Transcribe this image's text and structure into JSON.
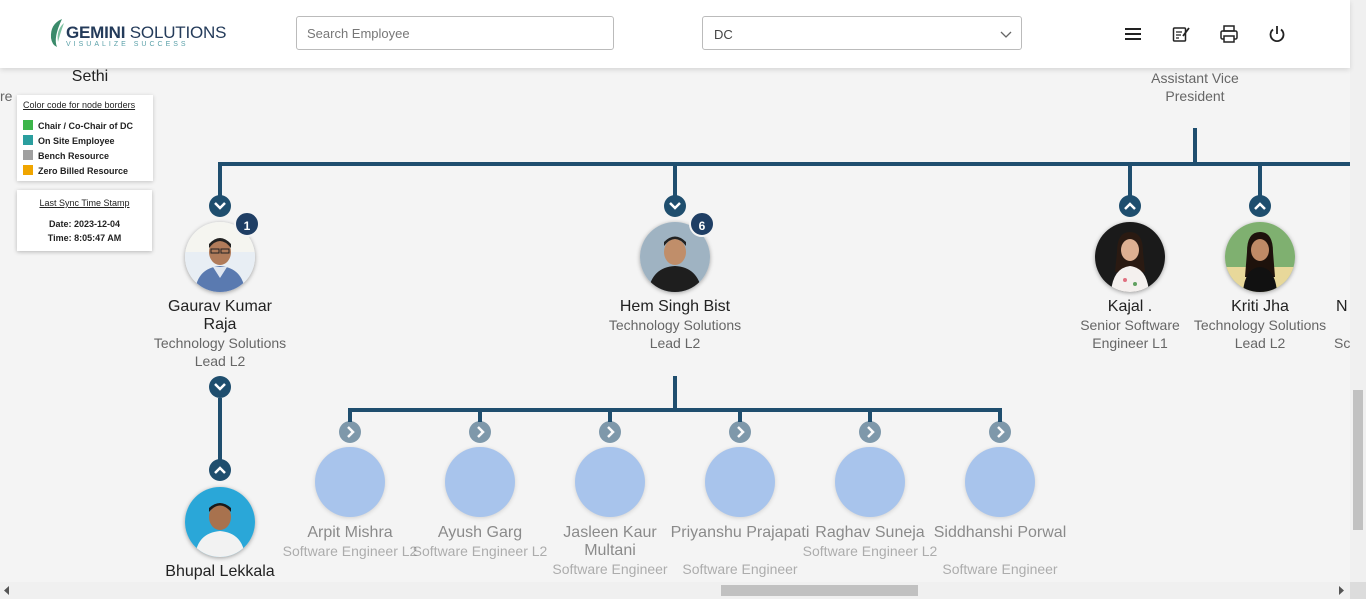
{
  "header": {
    "logo_brand": "GEMINI",
    "logo_suffix": "SOLUTIONS",
    "logo_tagline": "VISUALIZE SUCCESS",
    "search_placeholder": "Search Employee",
    "department_value": "DC",
    "icons": [
      "menu-icon",
      "notes-icon",
      "print-icon",
      "power-icon"
    ]
  },
  "legend": {
    "title": "Color code for node borders",
    "items": [
      {
        "label": "Chair / Co-Chair of DC",
        "color": "#3cb54a"
      },
      {
        "label": "On Site Employee",
        "color": "#2b9e9e"
      },
      {
        "label": "Bench Resource",
        "color": "#a0a0a0"
      },
      {
        "label": "Zero Billed Resource",
        "color": "#f0a500"
      }
    ]
  },
  "sync": {
    "title": "Last Sync Time Stamp",
    "date_line": "Date: 2023-12-04",
    "time_line": "Time: 8:05:47 AM"
  },
  "partial_nodes": {
    "left_name": "Sethi",
    "left_fragment": "re",
    "top_right_title": "Assistant Vice President",
    "right_edge_name": "N",
    "right_edge_title": "Sc"
  },
  "nodes": {
    "gaurav": {
      "name": "Gaurav Kumar Raja",
      "title": "Technology Solutions Lead L2",
      "badge": "1"
    },
    "hem": {
      "name": "Hem Singh Bist",
      "title": "Technology Solutions Lead L2",
      "badge": "6"
    },
    "kajal": {
      "name": "Kajal .",
      "title": "Senior Software Engineer L1"
    },
    "kriti": {
      "name": "Kriti Jha",
      "title": "Technology Solutions Lead L2"
    },
    "bhupal": {
      "name": "Bhupal Lekkala"
    },
    "reports": [
      {
        "name": "Arpit Mishra",
        "title": "Software Engineer L2"
      },
      {
        "name": "Ayush Garg",
        "title": "Software Engineer L2"
      },
      {
        "name": "Jasleen Kaur Multani",
        "title": "Software Engineer"
      },
      {
        "name": "Priyanshu Prajapati",
        "title": "Software Engineer"
      },
      {
        "name": "Raghav Suneja",
        "title": "Software Engineer L2"
      },
      {
        "name": "Siddhanshi Porwal",
        "title": "Software Engineer"
      }
    ]
  },
  "colors": {
    "edge": "#1f4e6e",
    "accent": "#1f3e64",
    "placeholder_avatar": "#a8c4ec"
  }
}
